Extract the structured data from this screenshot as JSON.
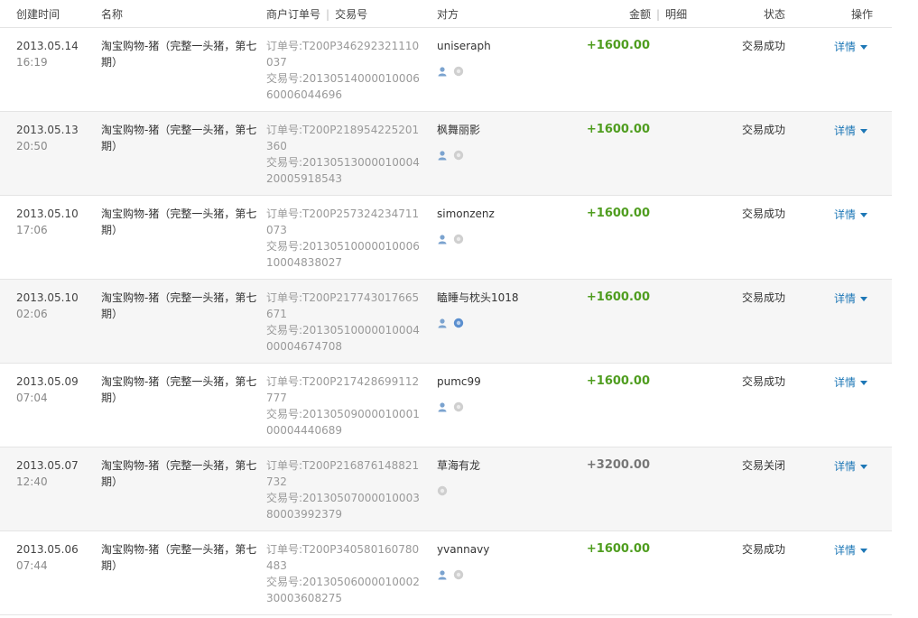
{
  "header": {
    "created_time": "创建时间",
    "name": "名称",
    "merchant_order_no": "商户订单号",
    "trade_no": "交易号",
    "counterparty": "对方",
    "amount": "金额",
    "detail": "明细",
    "status": "状态",
    "action": "操作"
  },
  "rows": [
    {
      "date": "2013.05.14",
      "time": "16:19",
      "name": "淘宝购物-猪（完整一头猪，第七期）",
      "order": "订单号:T200P346292321110037",
      "trade": "交易号:2013051400001000660006044696",
      "party": "uniseraph",
      "amount": "+1600.00",
      "amount_type": "in",
      "status": "交易成功",
      "action": "详情",
      "user_icon": true,
      "alipay_icon_active": false
    },
    {
      "date": "2013.05.13",
      "time": "20:50",
      "name": "淘宝购物-猪（完整一头猪，第七期）",
      "order": "订单号:T200P218954225201360",
      "trade": "交易号:2013051300001000420005918543",
      "party": "枫舞丽影",
      "amount": "+1600.00",
      "amount_type": "in",
      "status": "交易成功",
      "action": "详情",
      "user_icon": true,
      "alipay_icon_active": false
    },
    {
      "date": "2013.05.10",
      "time": "17:06",
      "name": "淘宝购物-猪（完整一头猪，第七期）",
      "order": "订单号:T200P257324234711073",
      "trade": "交易号:2013051000001000610004838027",
      "party": "simonzenz",
      "amount": "+1600.00",
      "amount_type": "in",
      "status": "交易成功",
      "action": "详情",
      "user_icon": true,
      "alipay_icon_active": false
    },
    {
      "date": "2013.05.10",
      "time": "02:06",
      "name": "淘宝购物-猪（完整一头猪，第七期）",
      "order": "订单号:T200P217743017665671",
      "trade": "交易号:2013051000001000400004674708",
      "party": "瞌睡与枕头1018",
      "amount": "+1600.00",
      "amount_type": "in",
      "status": "交易成功",
      "action": "详情",
      "user_icon": true,
      "alipay_icon_active": true
    },
    {
      "date": "2013.05.09",
      "time": "07:04",
      "name": "淘宝购物-猪（完整一头猪，第七期）",
      "order": "订单号:T200P217428699112777",
      "trade": "交易号:2013050900001000100004440689",
      "party": "pumc99",
      "amount": "+1600.00",
      "amount_type": "in",
      "status": "交易成功",
      "action": "详情",
      "user_icon": true,
      "alipay_icon_active": false
    },
    {
      "date": "2013.05.07",
      "time": "12:40",
      "name": "淘宝购物-猪（完整一头猪，第七期）",
      "order": "订单号:T200P216876148821732",
      "trade": "交易号:2013050700001000380003992379",
      "party": "草海有龙",
      "amount": "+3200.00",
      "amount_type": "closed",
      "status": "交易关闭",
      "action": "详情",
      "user_icon": false,
      "alipay_icon_active": false
    },
    {
      "date": "2013.05.06",
      "time": "07:44",
      "name": "淘宝购物-猪（完整一头猪，第七期）",
      "order": "订单号:T200P340580160780483",
      "trade": "交易号:2013050600001000230003608275",
      "party": "yvannavy",
      "amount": "+1600.00",
      "amount_type": "in",
      "status": "交易成功",
      "action": "详情",
      "user_icon": true,
      "alipay_icon_active": false
    }
  ]
}
